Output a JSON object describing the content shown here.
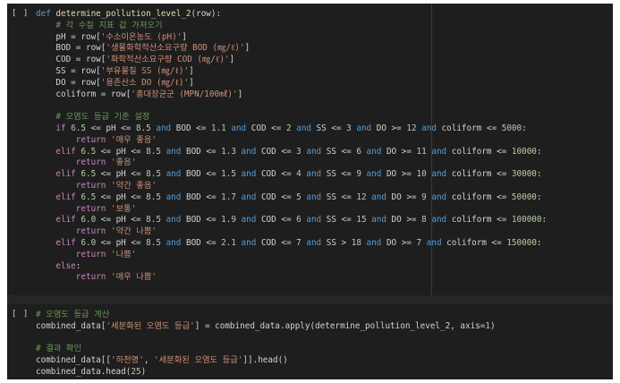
{
  "cells": [
    {
      "prompt": "[ ]",
      "lines": [
        [
          [
            "kwb",
            "def "
          ],
          [
            "fn",
            "determine_pollution_level_2"
          ],
          [
            "var",
            "(row):"
          ]
        ],
        [
          [
            "var",
            "    "
          ],
          [
            "cm",
            "# 각 수질 지표 값 가져오기"
          ]
        ],
        [
          [
            "var",
            "    pH = row["
          ],
          [
            "str",
            "'수소이온농도 (pH)'"
          ],
          [
            "var",
            "]"
          ]
        ],
        [
          [
            "var",
            "    BOD = row["
          ],
          [
            "str",
            "'생물화학적산소요구량 BOD (㎎/ℓ)'"
          ],
          [
            "var",
            "]"
          ]
        ],
        [
          [
            "var",
            "    COD = row["
          ],
          [
            "str",
            "'화학적산소요구량 COD (㎎/ℓ)'"
          ],
          [
            "var",
            "]"
          ]
        ],
        [
          [
            "var",
            "    SS = row["
          ],
          [
            "str",
            "'부유물질 SS (㎎/ℓ)'"
          ],
          [
            "var",
            "]"
          ]
        ],
        [
          [
            "var",
            "    DO = row["
          ],
          [
            "str",
            "'용존산소 DO (㎎/ℓ)'"
          ],
          [
            "var",
            "]"
          ]
        ],
        [
          [
            "var",
            "    coliform = row["
          ],
          [
            "str",
            "'총대장균군 (MPN/100㎖)'"
          ],
          [
            "var",
            "]"
          ]
        ],
        [],
        [
          [
            "var",
            "    "
          ],
          [
            "cm",
            "# 오염도 등급 기준 설정"
          ]
        ],
        [
          [
            "var",
            "    "
          ],
          [
            "kw",
            "if "
          ],
          [
            "num",
            "6.5"
          ],
          [
            "var",
            " <= pH <= "
          ],
          [
            "num",
            "8.5"
          ],
          [
            "kwb",
            " and "
          ],
          [
            "var",
            "BOD <= "
          ],
          [
            "num",
            "1.1"
          ],
          [
            "kwb",
            " and "
          ],
          [
            "var",
            "COD <= "
          ],
          [
            "num",
            "2"
          ],
          [
            "kwb",
            " and "
          ],
          [
            "var",
            "SS <= "
          ],
          [
            "num",
            "3"
          ],
          [
            "kwb",
            " and "
          ],
          [
            "var",
            "DO >= "
          ],
          [
            "num",
            "12"
          ],
          [
            "kwb",
            " and "
          ],
          [
            "var",
            "coliform <= "
          ],
          [
            "num",
            "5000"
          ],
          [
            "var",
            ":"
          ]
        ],
        [
          [
            "var",
            "        "
          ],
          [
            "kw",
            "return "
          ],
          [
            "str",
            "'매우 좋음'"
          ]
        ],
        [
          [
            "var",
            "    "
          ],
          [
            "kw",
            "elif "
          ],
          [
            "num",
            "6.5"
          ],
          [
            "var",
            " <= pH <= "
          ],
          [
            "num",
            "8.5"
          ],
          [
            "kwb",
            " and "
          ],
          [
            "var",
            "BOD <= "
          ],
          [
            "num",
            "1.3"
          ],
          [
            "kwb",
            " and "
          ],
          [
            "var",
            "COD <= "
          ],
          [
            "num",
            "3"
          ],
          [
            "kwb",
            " and "
          ],
          [
            "var",
            "SS <= "
          ],
          [
            "num",
            "6"
          ],
          [
            "kwb",
            " and "
          ],
          [
            "var",
            "DO >= "
          ],
          [
            "num",
            "11"
          ],
          [
            "kwb",
            " and "
          ],
          [
            "var",
            "coliform <= "
          ],
          [
            "num",
            "10000"
          ],
          [
            "var",
            ":"
          ]
        ],
        [
          [
            "var",
            "        "
          ],
          [
            "kw",
            "return "
          ],
          [
            "str",
            "'좋음'"
          ]
        ],
        [
          [
            "var",
            "    "
          ],
          [
            "kw",
            "elif "
          ],
          [
            "num",
            "6.5"
          ],
          [
            "var",
            " <= pH <= "
          ],
          [
            "num",
            "8.5"
          ],
          [
            "kwb",
            " and "
          ],
          [
            "var",
            "BOD <= "
          ],
          [
            "num",
            "1.5"
          ],
          [
            "kwb",
            " and "
          ],
          [
            "var",
            "COD <= "
          ],
          [
            "num",
            "4"
          ],
          [
            "kwb",
            " and "
          ],
          [
            "var",
            "SS <= "
          ],
          [
            "num",
            "9"
          ],
          [
            "kwb",
            " and "
          ],
          [
            "var",
            "DO >= "
          ],
          [
            "num",
            "10"
          ],
          [
            "kwb",
            " and "
          ],
          [
            "var",
            "coliform <= "
          ],
          [
            "num",
            "30000"
          ],
          [
            "var",
            ":"
          ]
        ],
        [
          [
            "var",
            "        "
          ],
          [
            "kw",
            "return "
          ],
          [
            "str",
            "'약간 좋음'"
          ]
        ],
        [
          [
            "var",
            "    "
          ],
          [
            "kw",
            "elif "
          ],
          [
            "num",
            "6.5"
          ],
          [
            "var",
            " <= pH <= "
          ],
          [
            "num",
            "8.5"
          ],
          [
            "kwb",
            " and "
          ],
          [
            "var",
            "BOD <= "
          ],
          [
            "num",
            "1.7"
          ],
          [
            "kwb",
            " and "
          ],
          [
            "var",
            "COD <= "
          ],
          [
            "num",
            "5"
          ],
          [
            "kwb",
            " and "
          ],
          [
            "var",
            "SS <= "
          ],
          [
            "num",
            "12"
          ],
          [
            "kwb",
            " and "
          ],
          [
            "var",
            "DO >= "
          ],
          [
            "num",
            "9"
          ],
          [
            "kwb",
            " and "
          ],
          [
            "var",
            "coliform <= "
          ],
          [
            "num",
            "50000"
          ],
          [
            "var",
            ":"
          ]
        ],
        [
          [
            "var",
            "        "
          ],
          [
            "kw",
            "return "
          ],
          [
            "str",
            "'보통'"
          ]
        ],
        [
          [
            "var",
            "    "
          ],
          [
            "kw",
            "elif "
          ],
          [
            "num",
            "6.0"
          ],
          [
            "var",
            " <= pH <= "
          ],
          [
            "num",
            "8.5"
          ],
          [
            "kwb",
            " and "
          ],
          [
            "var",
            "BOD <= "
          ],
          [
            "num",
            "1.9"
          ],
          [
            "kwb",
            " and "
          ],
          [
            "var",
            "COD <= "
          ],
          [
            "num",
            "6"
          ],
          [
            "kwb",
            " and "
          ],
          [
            "var",
            "SS <= "
          ],
          [
            "num",
            "15"
          ],
          [
            "kwb",
            " and "
          ],
          [
            "var",
            "DO >= "
          ],
          [
            "num",
            "8"
          ],
          [
            "kwb",
            " and "
          ],
          [
            "var",
            "coliform <= "
          ],
          [
            "num",
            "100000"
          ],
          [
            "var",
            ":"
          ]
        ],
        [
          [
            "var",
            "        "
          ],
          [
            "kw",
            "return "
          ],
          [
            "str",
            "'약간 나쁨'"
          ]
        ],
        [
          [
            "var",
            "    "
          ],
          [
            "kw",
            "elif "
          ],
          [
            "num",
            "6.0"
          ],
          [
            "var",
            " <= pH <= "
          ],
          [
            "num",
            "8.5"
          ],
          [
            "kwb",
            " and "
          ],
          [
            "var",
            "BOD <= "
          ],
          [
            "num",
            "2.1"
          ],
          [
            "kwb",
            " and "
          ],
          [
            "var",
            "COD <= "
          ],
          [
            "num",
            "7"
          ],
          [
            "kwb",
            " and "
          ],
          [
            "var",
            "SS > "
          ],
          [
            "num",
            "18"
          ],
          [
            "kwb",
            " and "
          ],
          [
            "var",
            "DO >= "
          ],
          [
            "num",
            "7"
          ],
          [
            "kwb",
            " and "
          ],
          [
            "var",
            "coliform <= "
          ],
          [
            "num",
            "150000"
          ],
          [
            "var",
            ":"
          ]
        ],
        [
          [
            "var",
            "        "
          ],
          [
            "kw",
            "return "
          ],
          [
            "str",
            "'나쁨'"
          ]
        ],
        [
          [
            "var",
            "    "
          ],
          [
            "kw",
            "else"
          ],
          [
            "var",
            ":"
          ]
        ],
        [
          [
            "var",
            "        "
          ],
          [
            "kw",
            "return "
          ],
          [
            "str",
            "'매우 나쁨'"
          ]
        ]
      ]
    },
    {
      "prompt": "[ ]",
      "lines": [
        [
          [
            "cm",
            "# 오염도 등급 계산"
          ]
        ],
        [
          [
            "var",
            "combined_data["
          ],
          [
            "str",
            "'세분화된 오염도 등급'"
          ],
          [
            "var",
            "] = combined_data.apply(determine_pollution_level_2, axis="
          ],
          [
            "num",
            "1"
          ],
          [
            "var",
            ")"
          ]
        ],
        [],
        [
          [
            "cm",
            "# 결과 확인"
          ]
        ],
        [
          [
            "var",
            "combined_data[["
          ],
          [
            "str",
            "'하천명'"
          ],
          [
            "var",
            ", "
          ],
          [
            "str",
            "'세분화된 오염도 등급'"
          ],
          [
            "var",
            "]].head()"
          ]
        ],
        [
          [
            "var",
            "combined_data.head("
          ],
          [
            "num",
            "25"
          ],
          [
            "var",
            ")"
          ]
        ]
      ]
    }
  ]
}
